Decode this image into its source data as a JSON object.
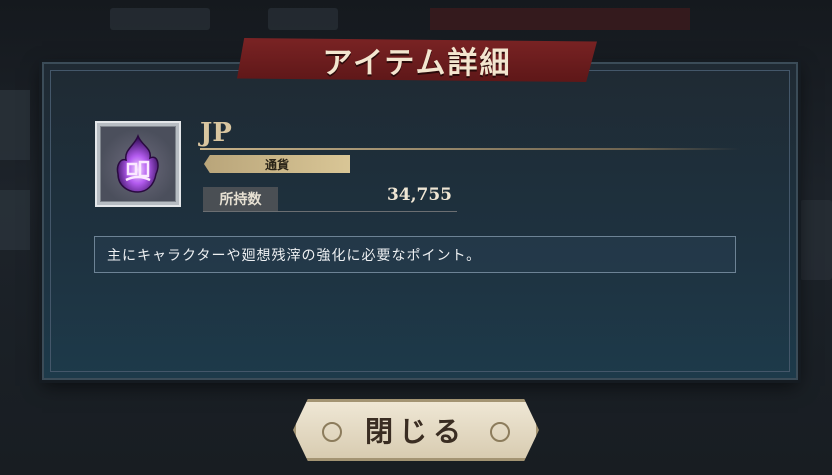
{
  "dialog": {
    "title": "アイテム詳細",
    "item": {
      "name": "JP",
      "category": "通貨",
      "owned_label": "所持数",
      "owned_value": "34,755",
      "icon": "purple-flame-points-icon"
    },
    "description": "主にキャラクターや廻想残滓の強化に必要なポイント。",
    "close_label": "閉じる"
  },
  "colors": {
    "ribbon": "#6e1c1d",
    "accent_gold": "#d9c696",
    "panel": "#1e3240"
  }
}
